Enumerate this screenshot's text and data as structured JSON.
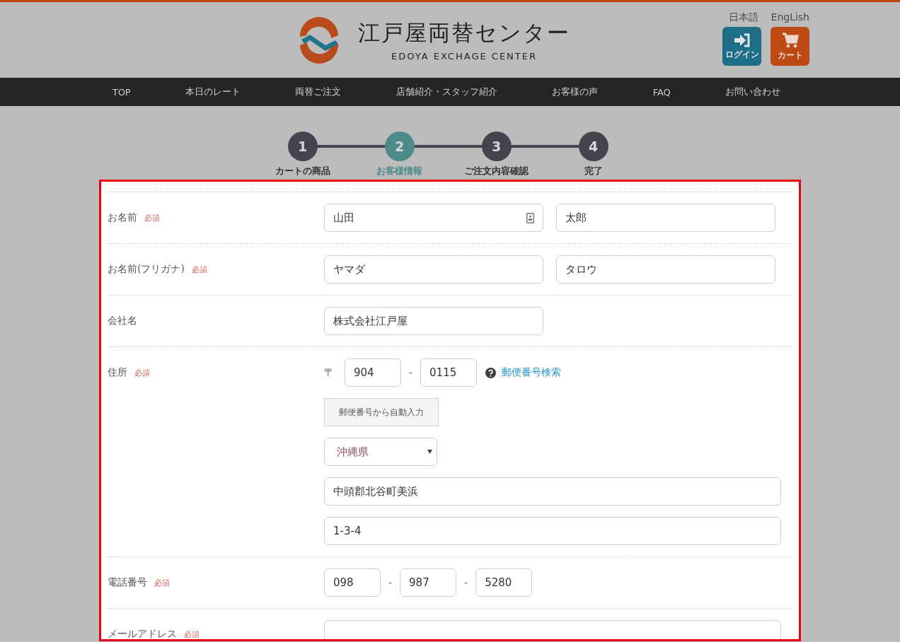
{
  "header": {
    "lang_links": [
      {
        "label": "日本語"
      },
      {
        "label": "EngLish"
      }
    ],
    "logo_title": "江戸屋両替センター",
    "logo_subtitle": "EDOYA EXCHAGE CENTER",
    "buttons": [
      {
        "kind": "login",
        "label": "ログイン"
      },
      {
        "kind": "cart",
        "label": "カート"
      }
    ]
  },
  "nav": [
    "TOP",
    "本日のレート",
    "両替ご注文",
    "店舗紹介・スタッフ紹介",
    "お客様の声",
    "FAQ",
    "お問い合わせ"
  ],
  "steps": [
    {
      "number": "1",
      "label": "カートの商品",
      "selected": false
    },
    {
      "number": "2",
      "label": "お客様情報",
      "selected": true
    },
    {
      "number": "3",
      "label": "ご注文内容確認",
      "selected": false
    },
    {
      "number": "4",
      "label": "完了",
      "selected": false
    }
  ],
  "form": {
    "rows": [
      {
        "kind": "pair",
        "label": "お名前",
        "badge": "必須",
        "fields": [
          {
            "value": "山田",
            "icon": true
          },
          {
            "value": "太郎",
            "icon": false
          }
        ]
      },
      {
        "kind": "pair",
        "label": "お名前(フリガナ)",
        "badge": "必須",
        "fields": [
          {
            "value": "ヤマダ",
            "icon": false
          },
          {
            "value": "タロウ",
            "icon": false
          }
        ]
      },
      {
        "kind": "single",
        "label": "会社名",
        "fields": [
          {
            "value": "株式会社江戸屋",
            "icon": false
          }
        ]
      },
      {
        "kind": "address",
        "label": "住所",
        "badge": "必須",
        "postal_mark": "〒",
        "postal": [
          {
            "value": "904"
          },
          {
            "value": "0115"
          }
        ],
        "postal_separator": "-",
        "search_link": "郵便番号検索",
        "autofill_button": "郵便番号から自動入力",
        "prefecture": "沖縄県",
        "lines": [
          {
            "value": "中頭郡北谷町美浜"
          },
          {
            "value": "1-3-4"
          }
        ]
      },
      {
        "kind": "phone",
        "label": "電話番号",
        "badge": "必須",
        "fields": [
          {
            "value": "098"
          },
          {
            "value": "987"
          },
          {
            "value": "5280"
          }
        ],
        "separators": [
          "-",
          "-"
        ]
      },
      {
        "kind": "wide",
        "label": "メールアドレス",
        "badge": "必須",
        "fields": [
          {
            "icon": false
          }
        ]
      }
    ]
  }
}
